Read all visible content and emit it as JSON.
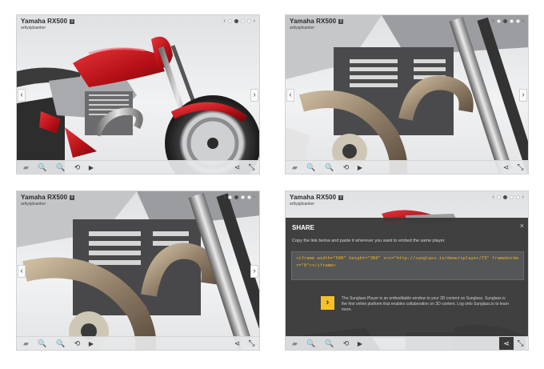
{
  "players": [
    {
      "title": "Yamaha RX500",
      "author": "arttysjdsanker",
      "active_dot": 2
    },
    {
      "title": "Yamaha RX500",
      "author": "arttysjdsanker",
      "active_dot": 2
    },
    {
      "title": "Yamaha RX500",
      "author": "arttysjdsanker",
      "active_dot": 2
    },
    {
      "title": "Yamaha RX500",
      "author": "arttysjdsanker",
      "active_dot": 2
    }
  ],
  "share": {
    "title": "SHARE",
    "close": "×",
    "instruction": "Copy the link below and paste it wherever you want to embed the same player.",
    "embed_code": "<iframe width=\"500\" height=\"360\" src=\"http://sunglass.io/demo/splayer/73\" frameborder=\"0\"></iframe>",
    "promo": "The Sunglass Player is an embeddable window to your 3D content on Sunglass. Sunglass is the first online platform that enables collaboration on 3D content. Log onto Sunglass.io to learn more."
  },
  "icons": {
    "info": "i",
    "prev_arrow": "‹",
    "next_arrow": "›",
    "side_left": "‹",
    "side_right": "›",
    "logo": "▰",
    "zoom_in": "🔍+",
    "zoom_out": "🔍−",
    "rotate": "⟲",
    "play": "▶",
    "share": "⋖",
    "fullscreen": "⤡",
    "promo_logo": "›"
  },
  "colors": {
    "bike_red": "#c8141c",
    "accent_yellow": "#f5c02a",
    "embed_text": "#f0b429"
  }
}
